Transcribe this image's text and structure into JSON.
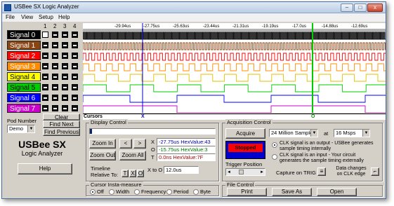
{
  "window": {
    "title": "USBee SX Logic Analyzer",
    "minimize": "–",
    "maximize": "□",
    "close": "x"
  },
  "menu": [
    "File",
    "View",
    "Setup",
    "Help"
  ],
  "columns": [
    "1",
    "2",
    "3",
    "4"
  ],
  "signals": [
    {
      "label": "Signal 0",
      "color": "#000000",
      "text": "#ffffff"
    },
    {
      "label": "Signal 1",
      "color": "#8b4513",
      "text": "#ffffff"
    },
    {
      "label": "Signal 2",
      "color": "#ff0000",
      "text": "#ffffff"
    },
    {
      "label": "Signal 3",
      "color": "#ff8c00",
      "text": "#ffffff"
    },
    {
      "label": "Signal 4",
      "color": "#ffff00",
      "text": "#000000"
    },
    {
      "label": "Signal 5",
      "color": "#00cc00",
      "text": "#000000"
    },
    {
      "label": "Signal 6",
      "color": "#0000ff",
      "text": "#ffffff"
    },
    {
      "label": "Signal 7",
      "color": "#cc00cc",
      "text": "#ffffff"
    }
  ],
  "time_ticks": [
    "-29.94us",
    "-27.75us",
    "-25.63us",
    "-23.44us",
    "-21.31us",
    "-19.19us",
    "-17.0us",
    "-14.88us",
    "-12.69us"
  ],
  "cursors": {
    "label": "Cursors",
    "x": "X",
    "o": "O"
  },
  "left_panel": {
    "clear": "Clear",
    "find_next": "Find Next",
    "find_previous": "Find Previous",
    "pod_number_label": "Pod Number",
    "pod_number_value": "Demo",
    "brand_line1": "USBee SX",
    "brand_line2": "Logic Analyzer",
    "help": "Help"
  },
  "display_control": {
    "title": "Display Control",
    "zoom_in": "Zoom In",
    "zoom_out": "Zoom Out",
    "zoom_all": "Zoom All",
    "prev": "<",
    "next": ">",
    "x_label": "X",
    "o_label": "O",
    "t_label": "T",
    "x_value": "-27.75us HexValue:43",
    "o_value": "-15.75us HexValue:3",
    "t_value": "0.0ns HexValue:7F",
    "timeline_label": "Timeline",
    "relative_label": "Relative To:",
    "rel_t": "T",
    "rel_x": "X",
    "rel_o": "O",
    "x_to_o_label": "X to O",
    "x_to_o_value": "12.0us"
  },
  "insta_measure": {
    "title": "Cursor Insta-measure",
    "options": [
      "Off",
      "Width",
      "Frequency",
      "Period",
      "Byte"
    ],
    "selected": 0
  },
  "acquisition": {
    "title": "Acquisition Control",
    "acquire": "Acquire",
    "samples": "24 Million Samples",
    "at_label": "at",
    "rate": "16 Msps",
    "status": "Stopped",
    "trigger_position": "Trigger Position",
    "clk_output": "CLK signal is an output - USBee generates sample timing internally",
    "clk_input": "CLK signal is an input - Your circuit generates the sample timing externally",
    "capture_on_trig": "Capture on TRIG",
    "data_changes": "Data changes on CLK edge"
  },
  "file_control": {
    "title": "File Control",
    "print": "Print",
    "save_as": "Save As",
    "open": "Open"
  }
}
